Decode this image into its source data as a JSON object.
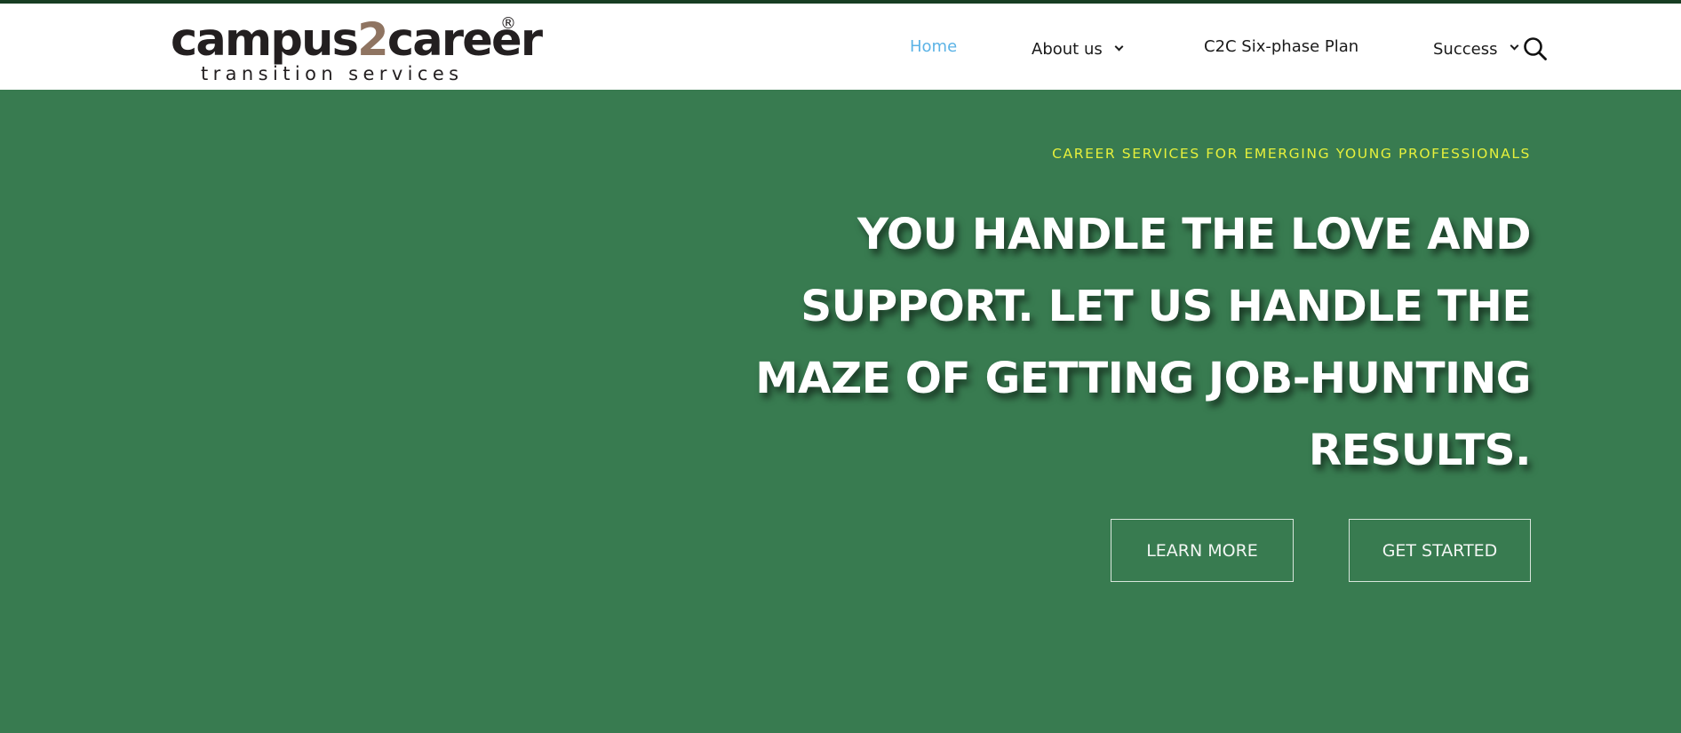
{
  "brand": {
    "logo_main_left": "campus",
    "logo_main_two": "2",
    "logo_main_right": "career",
    "logo_registered": "®",
    "logo_sub": "transition services"
  },
  "nav": {
    "items": [
      {
        "label": "Home",
        "active": true,
        "has_dropdown": false
      },
      {
        "label": "About us",
        "active": false,
        "has_dropdown": true
      },
      {
        "label": "C2C Six-phase Plan",
        "active": false,
        "has_dropdown": false
      },
      {
        "label": "Success",
        "active": false,
        "has_dropdown": true
      }
    ],
    "search_icon": "search-icon"
  },
  "hero": {
    "tagline": "CAREER SERVICES FOR EMERGING YOUNG PROFESSIONALS",
    "headline_lines": [
      "YOU HANDLE THE LOVE AND",
      "SUPPORT. LET US HANDLE THE",
      "MAZE OF GETTING JOB-HUNTING",
      "RESULTS."
    ],
    "buttons": {
      "learn_more": "LEARN MORE",
      "get_started": "GET STARTED"
    }
  },
  "colors": {
    "hero_background": "#387b50",
    "top_border": "#173d22",
    "nav_active": "#5bb3e6",
    "tagline": "#e6f03c",
    "logo_accent": "#8f7461"
  }
}
